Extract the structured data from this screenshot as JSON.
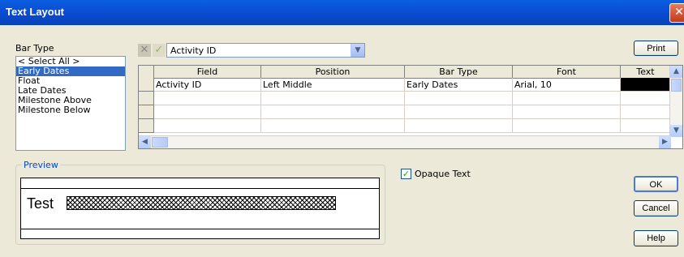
{
  "window": {
    "title": "Text Layout"
  },
  "bar_type": {
    "label": "Bar Type",
    "items": [
      "< Select All >",
      "Early Dates",
      "Float",
      "Late Dates",
      "Milestone Above",
      "Milestone Below"
    ],
    "selected": "Early Dates"
  },
  "field_selector": {
    "value": "Activity ID"
  },
  "grid": {
    "columns": [
      "Field",
      "Position",
      "Bar Type",
      "Font",
      "Text"
    ],
    "rows": [
      {
        "field": "Activity ID",
        "position": "Left Middle",
        "bar_type": "Early Dates",
        "font": "Arial, 10",
        "text_color": "#000000"
      }
    ]
  },
  "buttons": {
    "print": "Print",
    "ok": "OK",
    "cancel": "Cancel",
    "help": "Help"
  },
  "preview": {
    "label": "Preview",
    "sample_text": "Test"
  },
  "options": {
    "opaque_text_label": "Opaque Text",
    "opaque_text_checked": true
  },
  "colors": {
    "title_bar": "#0a4fd6",
    "selection": "#316ac5",
    "group_label": "#0046d5"
  },
  "icons": {
    "cancel_edit": "x-icon",
    "accept_edit": "check-icon",
    "dropdown": "chevron-down-icon",
    "close": "close-icon"
  }
}
